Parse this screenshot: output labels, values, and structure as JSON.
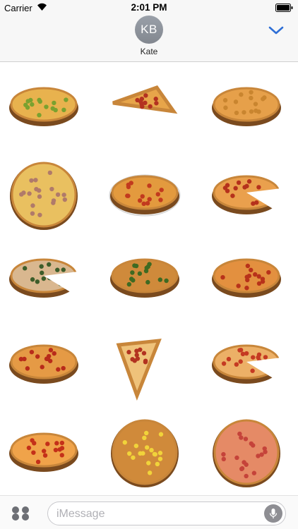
{
  "status_bar": {
    "carrier": "Carrier",
    "time": "2:01 PM"
  },
  "header": {
    "avatar_initials": "KB",
    "contact_name": "Kate"
  },
  "stickers": [
    {
      "name": "supreme-pizza",
      "kind": "whole-oval",
      "base": "#e8b24e",
      "toppings": "#7aa12f"
    },
    {
      "name": "pepperoni-slice",
      "kind": "slice",
      "base": "#e7a54a",
      "toppings": "#b33220"
    },
    {
      "name": "cheese-pizza",
      "kind": "whole-oval",
      "base": "#e6a04a",
      "toppings": "#c9852f"
    },
    {
      "name": "ham-pizza",
      "kind": "whole-round",
      "base": "#e9c060",
      "toppings": "#b07a6a"
    },
    {
      "name": "pizza-on-plate",
      "kind": "plate",
      "base": "#e39a3e",
      "toppings": "#c23a1e"
    },
    {
      "name": "sliced-pepperoni-pizza",
      "kind": "cut-oval",
      "base": "#eaa04d",
      "toppings": "#b5311c"
    },
    {
      "name": "veggie-pizza-cut",
      "kind": "cut-oval",
      "base": "#d9b78f",
      "toppings": "#3d5d2a"
    },
    {
      "name": "broccoli-pizza",
      "kind": "whole-oval",
      "base": "#cf8a3b",
      "toppings": "#3e6a22"
    },
    {
      "name": "pepperoni-pizza-board",
      "kind": "whole-oval",
      "base": "#e3903f",
      "toppings": "#b8321a"
    },
    {
      "name": "pepperoni-pizza-tray",
      "kind": "whole-oval",
      "base": "#e59a45",
      "toppings": "#b82b1a"
    },
    {
      "name": "large-pepperoni-slice",
      "kind": "slice",
      "base": "#efc27a",
      "toppings": "#b23220"
    },
    {
      "name": "missing-slice-pizza",
      "kind": "cut-oval",
      "base": "#ecb067",
      "toppings": "#c53a22"
    },
    {
      "name": "classic-pepperoni",
      "kind": "whole-oval",
      "base": "#f0a34a",
      "toppings": "#c43019"
    },
    {
      "name": "hawaiian-pizza",
      "kind": "whole-round",
      "base": "#d08a3a",
      "toppings": "#f1d33a"
    },
    {
      "name": "margherita-pizza",
      "kind": "whole-round",
      "base": "#e58a66",
      "toppings": "#c5433a"
    }
  ],
  "bottom_bar": {
    "placeholder": "iMessage"
  },
  "colors": {
    "accent": "#2f6fd6",
    "bar_bg": "#f7f7f7"
  }
}
